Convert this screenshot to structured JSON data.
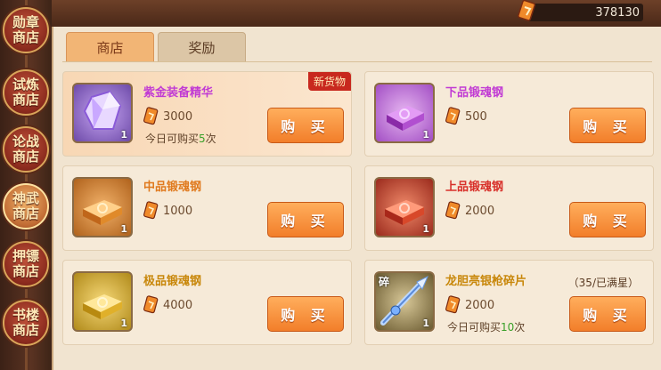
{
  "sidebar": {
    "items": [
      {
        "label": "勋章\n商店"
      },
      {
        "label": "试炼\n商店"
      },
      {
        "label": "论战\n商店"
      },
      {
        "label": "神武\n商店"
      },
      {
        "label": "押镖\n商店"
      },
      {
        "label": "书楼\n商店"
      }
    ]
  },
  "header": {
    "currency_value": "378130",
    "currency_icon": "coupon-icon"
  },
  "tabs": [
    {
      "label": "商店"
    },
    {
      "label": "奖励"
    }
  ],
  "shop": {
    "buy_label": "购 买",
    "items": [
      {
        "name": "紫金装备精华",
        "price": "3000",
        "count": "1",
        "limit_prefix": "今日可购买",
        "limit_value": "5",
        "limit_suffix": "次",
        "badge": "新货物",
        "name_color": "#c13bd4"
      },
      {
        "name": "下品锻魂钢",
        "price": "500",
        "count": "1",
        "name_color": "#c13bd4"
      },
      {
        "name": "中品锻魂钢",
        "price": "1000",
        "count": "1",
        "name_color": "#e07a1e"
      },
      {
        "name": "上品锻魂钢",
        "price": "2000",
        "count": "1",
        "name_color": "#d8302a"
      },
      {
        "name": "极品锻魂钢",
        "price": "4000",
        "count": "1",
        "name_color": "#c8870a"
      },
      {
        "name": "龙胆亮银枪碎片",
        "price": "2000",
        "count": "1",
        "tag": "碎",
        "progress": "（35/已满星）",
        "limit_prefix": "今日可购买",
        "limit_value": "10",
        "limit_suffix": "次",
        "name_color": "#c8870a"
      }
    ]
  }
}
